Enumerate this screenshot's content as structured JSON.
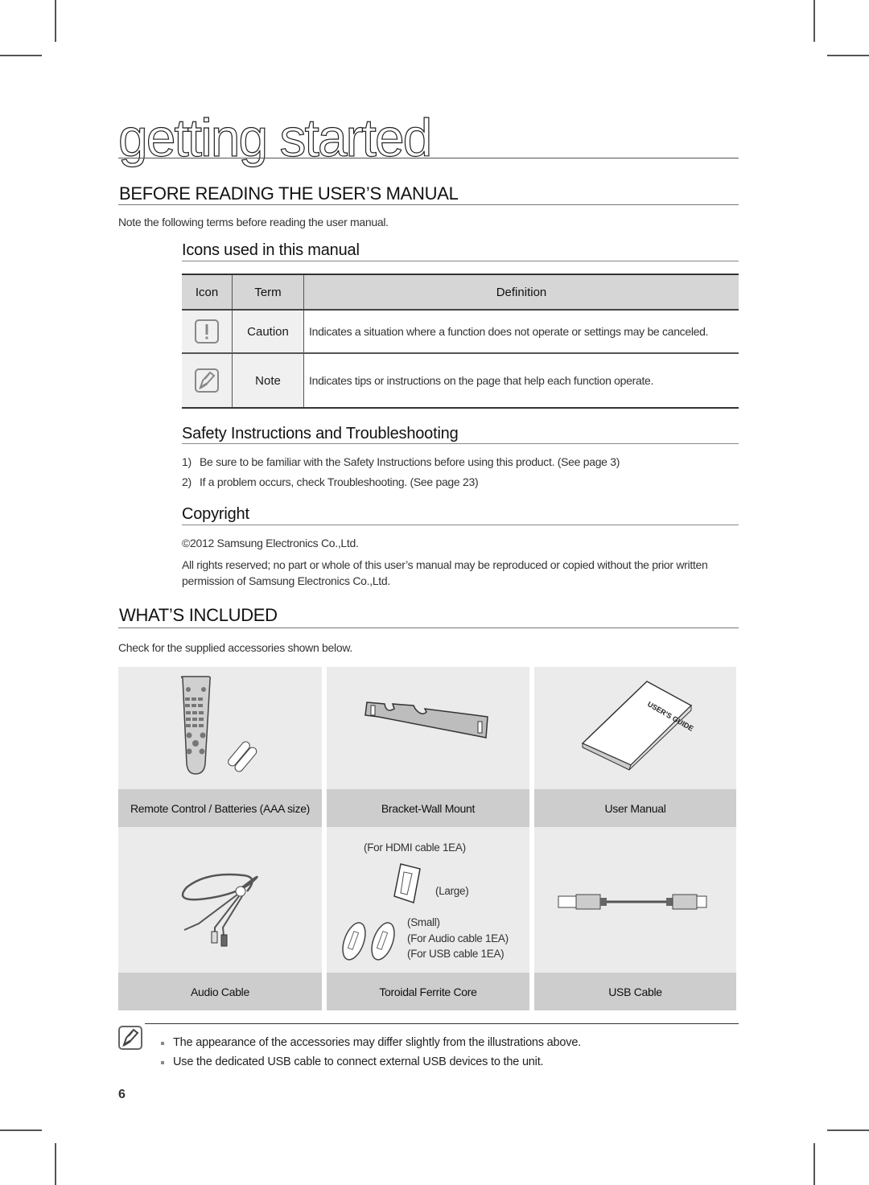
{
  "page": {
    "title": "getting started",
    "page_number": "6"
  },
  "before_reading": {
    "heading": "BEFORE READING THE USER’S MANUAL",
    "intro": "Note the following terms before reading the user manual.",
    "icons_section": {
      "heading": "Icons used in this manual",
      "columns": [
        "Icon",
        "Term",
        "Definition"
      ],
      "rows": [
        {
          "icon": "caution-icon",
          "term": "Caution",
          "definition": "Indicates a situation where a function does not operate or settings may be canceled."
        },
        {
          "icon": "note-icon",
          "term": "Note",
          "definition": "Indicates tips or instructions on the page that help each function operate."
        }
      ]
    },
    "safety_section": {
      "heading": "Safety Instructions and Troubleshooting",
      "items": [
        {
          "num": "1)",
          "text": "Be sure to be familiar with the Safety Instructions before using this product. (See page 3)"
        },
        {
          "num": "2)",
          "text": "If a problem occurs, check Troubleshooting. (See page 23)"
        }
      ]
    },
    "copyright_section": {
      "heading": "Copyright",
      "line1": "©2012 Samsung Electronics Co.,Ltd.",
      "line2": "All rights reserved; no part or whole of this user’s manual may be reproduced or copied without the prior written permission of Samsung Electronics Co.,Ltd."
    }
  },
  "whats_included": {
    "heading": "WHAT’S INCLUDED",
    "intro": "Check for the supplied accessories shown below.",
    "items": [
      {
        "label": "Remote Control / Batteries (AAA size)",
        "illustration": "remote-control-illustration"
      },
      {
        "label": "Bracket-Wall Mount",
        "illustration": "wall-bracket-illustration",
        "book_text": ""
      },
      {
        "label": "User Manual",
        "illustration": "user-manual-illustration",
        "book_text": "USER'S GUIDE"
      },
      {
        "label": "Audio Cable",
        "illustration": "audio-cable-illustration"
      },
      {
        "label": "Toroidal Ferrite Core",
        "illustration": "ferrite-core-illustration",
        "notes": {
          "hdmi": "(For HDMI cable 1EA)",
          "large": "(Large)",
          "small": "(Small)",
          "audio": "(For Audio cable 1EA)",
          "usb": "(For USB cable 1EA)"
        }
      },
      {
        "label": "USB Cable",
        "illustration": "usb-cable-illustration"
      }
    ],
    "notes": [
      "The appearance of the accessories may differ slightly from the illustrations above.",
      "Use the dedicated USB cable to connect external USB devices to the unit."
    ]
  }
}
